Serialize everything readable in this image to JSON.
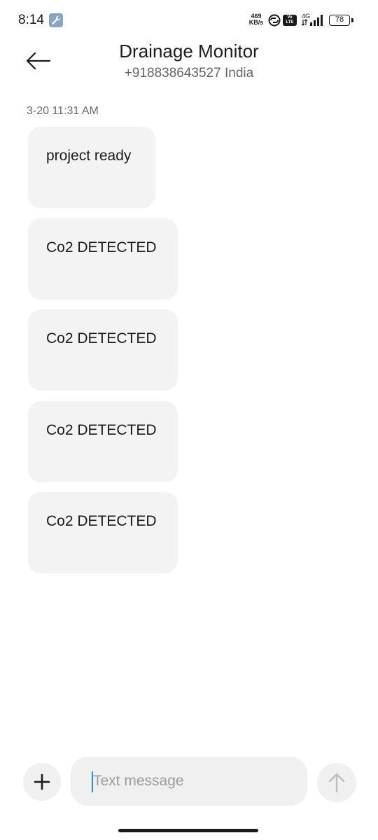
{
  "status_bar": {
    "time": "8:14",
    "net_speed_value": "469",
    "net_speed_unit": "KB/s",
    "volte_top": "Vo",
    "volte_bottom": "LTE",
    "network_type": "4G",
    "battery": "78",
    "icons": [
      "wrench-icon",
      "link-icon",
      "volte-icon",
      "signal-icon",
      "battery-icon"
    ]
  },
  "header": {
    "back_icon": "arrow-left-icon",
    "contact_name": "Drainage Monitor",
    "contact_number": "+918838643527 India"
  },
  "conversation": {
    "timestamp": "3-20 11:31 AM",
    "messages": [
      "project ready",
      "Co2 DETECTED",
      "Co2 DETECTED",
      "Co2 DETECTED",
      "Co2 DETECTED"
    ]
  },
  "composer": {
    "add_icon": "plus-icon",
    "placeholder": "Text message",
    "value": "",
    "send_icon": "arrow-up-icon"
  },
  "colors": {
    "bubble_background": "#f3f3f3",
    "composer_background": "#f0f0f0",
    "caret": "#2a8be6",
    "send_icon_disabled": "#bdbdbd"
  }
}
